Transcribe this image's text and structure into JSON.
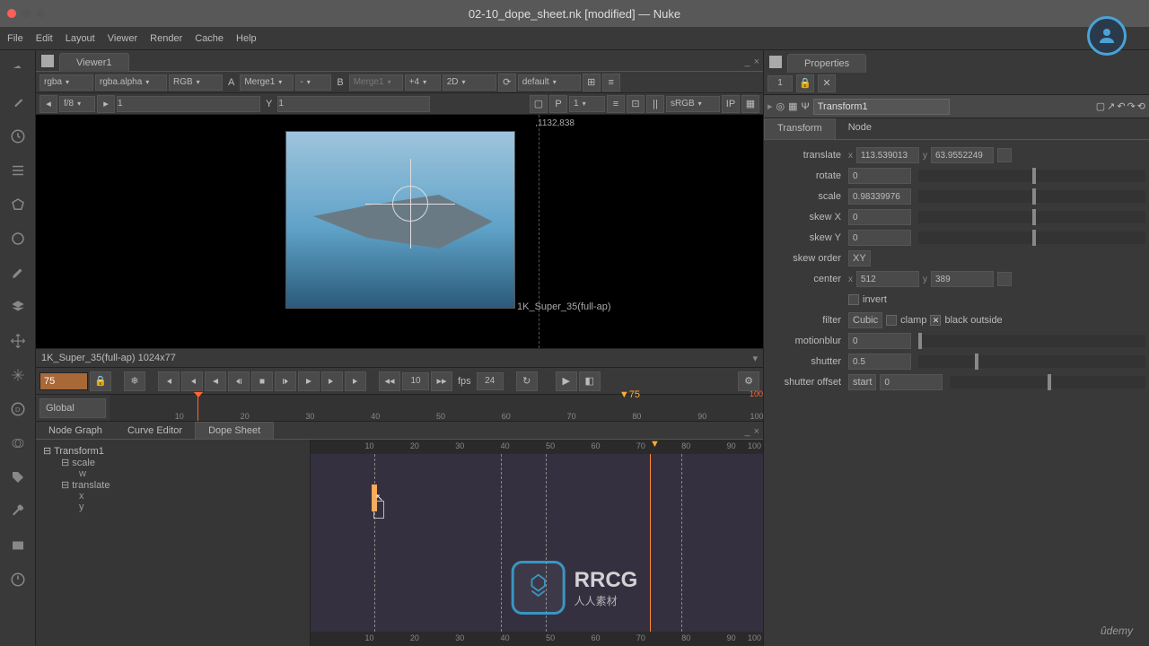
{
  "app": {
    "title": "02-10_dope_sheet.nk [modified] — Nuke"
  },
  "menubar": [
    "File",
    "Edit",
    "Layout",
    "Viewer",
    "Render",
    "Cache",
    "Help"
  ],
  "viewer": {
    "tab": "Viewer1",
    "row1": {
      "channel": "rgba",
      "alpha": "rgba.alpha",
      "colorspace": "RGB",
      "a_label": "A",
      "a_node": "Merge1",
      "dash": "-",
      "b_label": "B",
      "b_node": "Merge1",
      "exposure": "+4",
      "dim": "2D",
      "handles": "default"
    },
    "row2": {
      "fstop": "f/8",
      "one": "1",
      "y_lbl": "Y",
      "y_val": "1",
      "val2": "1",
      "lut": "sRGB",
      "ip": "IP"
    },
    "coords": ",1132,838",
    "format_overlay": "1K_Super_35(full-ap)",
    "format_bar": "1K_Super_35(full-ap) 1024x77"
  },
  "playback": {
    "frame": "75",
    "jump": "10",
    "fps_label": "fps",
    "fps": "24",
    "range_mode": "Global"
  },
  "timeline": {
    "ticks": [
      "10",
      "20",
      "30",
      "40",
      "50",
      "60",
      "70",
      "80",
      "90",
      "100"
    ],
    "marker": "75",
    "end_marker": "100"
  },
  "bottom_tabs": {
    "nodegraph": "Node Graph",
    "curve": "Curve Editor",
    "dope": "Dope Sheet"
  },
  "dope": {
    "tree": {
      "root": "Transform1",
      "p1": "scale",
      "p1c": "w",
      "p2": "translate",
      "p2c1": "x",
      "p2c2": "y"
    },
    "ruler": [
      "10",
      "20",
      "30",
      "40",
      "50",
      "60",
      "70",
      "80",
      "90",
      "100"
    ]
  },
  "properties": {
    "title": "Properties",
    "count": "1",
    "node_name": "Transform1",
    "tabs": {
      "transform": "Transform",
      "node": "Node"
    },
    "params": {
      "translate_label": "translate",
      "translate_x": "113.539013",
      "translate_y": "63.9552249",
      "rotate_label": "rotate",
      "rotate": "0",
      "scale_label": "scale",
      "scale": "0.98339976",
      "skewx_label": "skew X",
      "skewx": "0",
      "skewy_label": "skew Y",
      "skewy": "0",
      "skeworder_label": "skew order",
      "skeworder": "XY",
      "center_label": "center",
      "center_x": "512",
      "center_y": "389",
      "invert_label": "invert",
      "filter_label": "filter",
      "filter": "Cubic",
      "clamp_label": "clamp",
      "blackoutside_label": "black outside",
      "motionblur_label": "motionblur",
      "motionblur": "0",
      "shutter_label": "shutter",
      "shutter": "0.5",
      "shutteroffset_label": "shutter offset",
      "shutteroffset": "start",
      "shutteroffset_val": "0"
    }
  },
  "watermark": {
    "text": "RRCG",
    "sub": "人人素材"
  },
  "footer": {
    "udemy": "ûdemy"
  }
}
